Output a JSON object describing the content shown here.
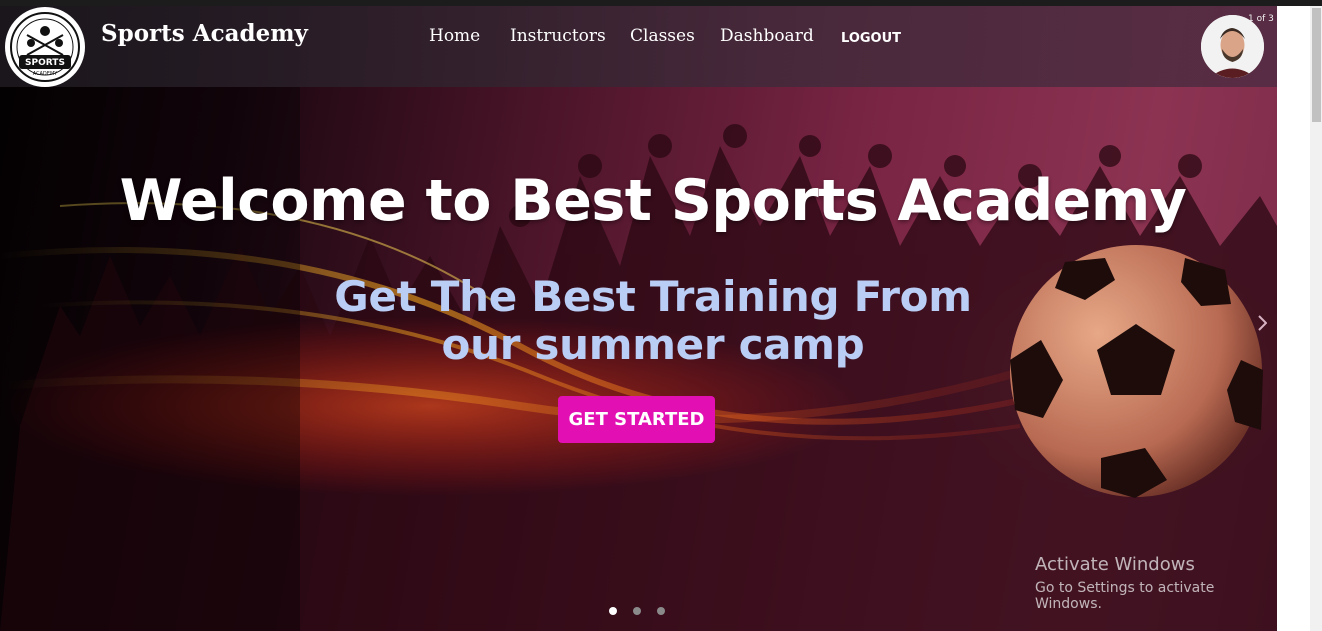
{
  "brand": {
    "name": "Sports Academy",
    "logo_text": "SPORTS",
    "logo_sub": "ACADEMY"
  },
  "nav": {
    "items": [
      {
        "label": "Home"
      },
      {
        "label": "Instructors"
      },
      {
        "label": "Classes"
      },
      {
        "label": "Dashboard"
      }
    ],
    "logout": "LOGOUT"
  },
  "slider": {
    "counter": "1 of 3",
    "headline": "Welcome to Best Sports Academy",
    "subline_1": "Get The Best Training From",
    "subline_2": "our summer camp",
    "cta": "GET STARTED",
    "active_slide": 1,
    "total_slides": 3
  },
  "watermark": {
    "title": "Activate Windows",
    "subtitle": "Go to Settings to activate Windows."
  },
  "colors": {
    "cta": "#e20fb2",
    "subline": "#b9cdf5",
    "hero_bg": "#7a2544",
    "nav_bg": "#2a2430"
  }
}
